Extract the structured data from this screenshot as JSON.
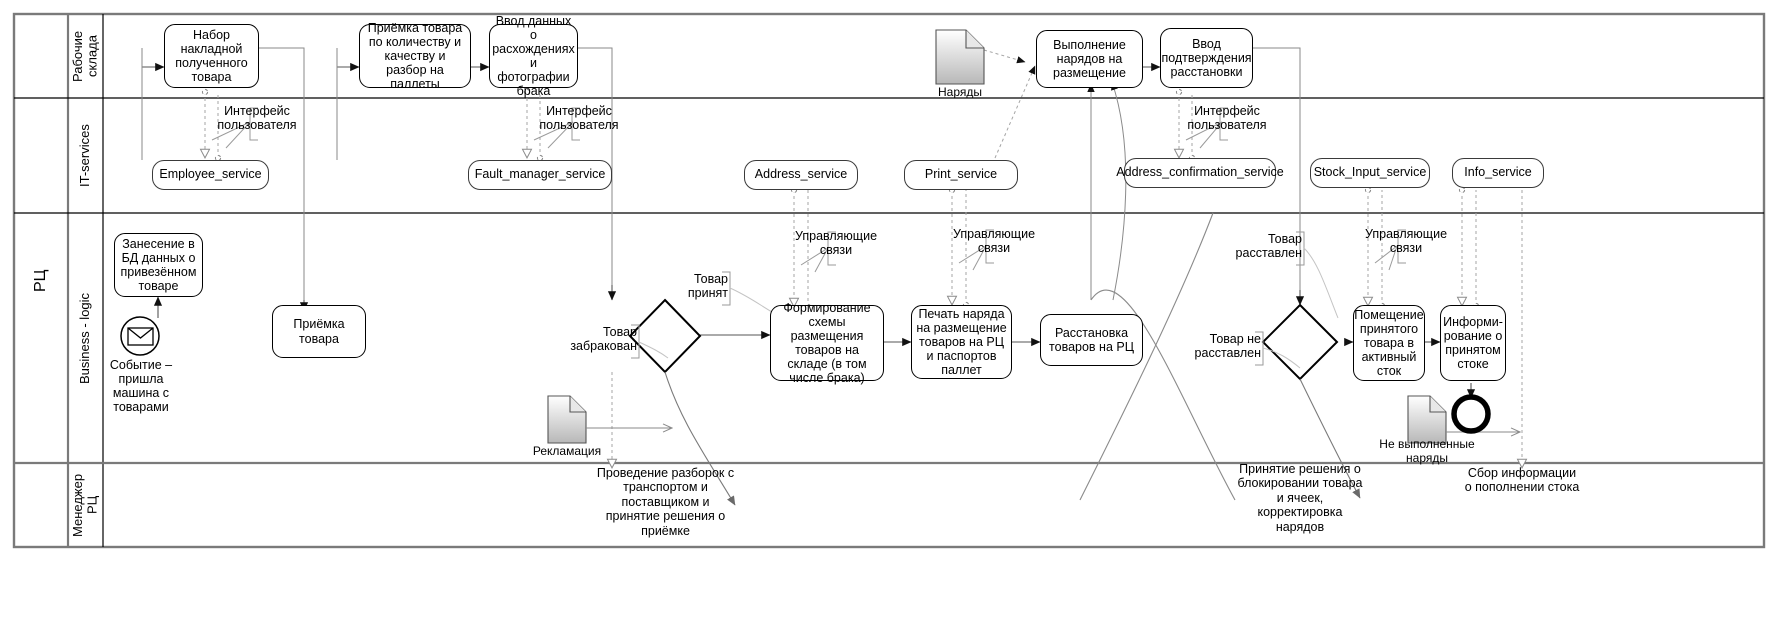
{
  "diagram": {
    "title": "РЦ",
    "pool_label": "РЦ",
    "type": "bpmn-swimlane"
  },
  "lanes": [
    {
      "id": "workers",
      "label": "Рабочие склада"
    },
    {
      "id": "it",
      "label": "IT-services"
    },
    {
      "id": "business",
      "label": "Business - logic"
    },
    {
      "id": "manager",
      "label": "Менеджер РЦ"
    }
  ],
  "tasks": {
    "t1": "Набор накладной полученного товара",
    "t2": "Приёмка товара по количеству и качеству и разбор на паллеты",
    "t3": "Ввод данных о расхождениях и фотографии брака",
    "t4": "Выполнение нарядов на размещение",
    "t5": "Ввод подтверждения расстановки",
    "t6": "Занесение в БД данных о привезённом товаре",
    "t7": "Приёмка товара",
    "t8": "Формирование схемы размещения товаров на складе (в том числе брака)",
    "t9": "Печать наряда на размещение товаров на РЦ и паспортов паллет",
    "t10": "Расстановка товаров на РЦ",
    "t11": "Помещение принятого товара в активный сток",
    "t12": "Информи-рование о принятом стоке"
  },
  "services": {
    "s1": "Employee_service",
    "s2": "Fault_manager_service",
    "s3": "Address_service",
    "s4": "Print_service",
    "s5": "Address_confirmation_service",
    "s6": "Stock_Input_service",
    "s7": "Info_service"
  },
  "annotations": {
    "a1": "Интерфейс пользователя",
    "a2": "Интерфейс пользователя",
    "a3": "Интерфейс пользователя",
    "a4": "Управляющие связи",
    "a5": "Управляющие связи",
    "a6": "Управляющие связи"
  },
  "documents": {
    "d1": "Наряды",
    "d2": "Рекламация",
    "d3": "Не выполненные наряды"
  },
  "events": {
    "start": "Событие – пришла машина с товарами",
    "end": "end-event"
  },
  "flow_labels": {
    "f1": "Товар принят",
    "f2": "Товар забракован",
    "f3": "Товар расставлен",
    "f4": "Товар не расставлен"
  },
  "manager_notes": {
    "m1": "Проведение разборок с транспортом и поставщиком и принятие решения о приёмке",
    "m2": "Принятие решения о блокировании товара и ячеек, корректировка нарядов",
    "m3": "Сбор информации о пополнении стока"
  },
  "colors": {
    "pool_border": "#7a7a7a",
    "lane_border": "#000000",
    "task_border": "#000000",
    "service_border": "#3a3a3a",
    "flow": "#555555",
    "assoc": "#9a9a9a",
    "doc_fill_top": "#ffffff",
    "doc_fill_bottom": "#bfbfbf"
  }
}
